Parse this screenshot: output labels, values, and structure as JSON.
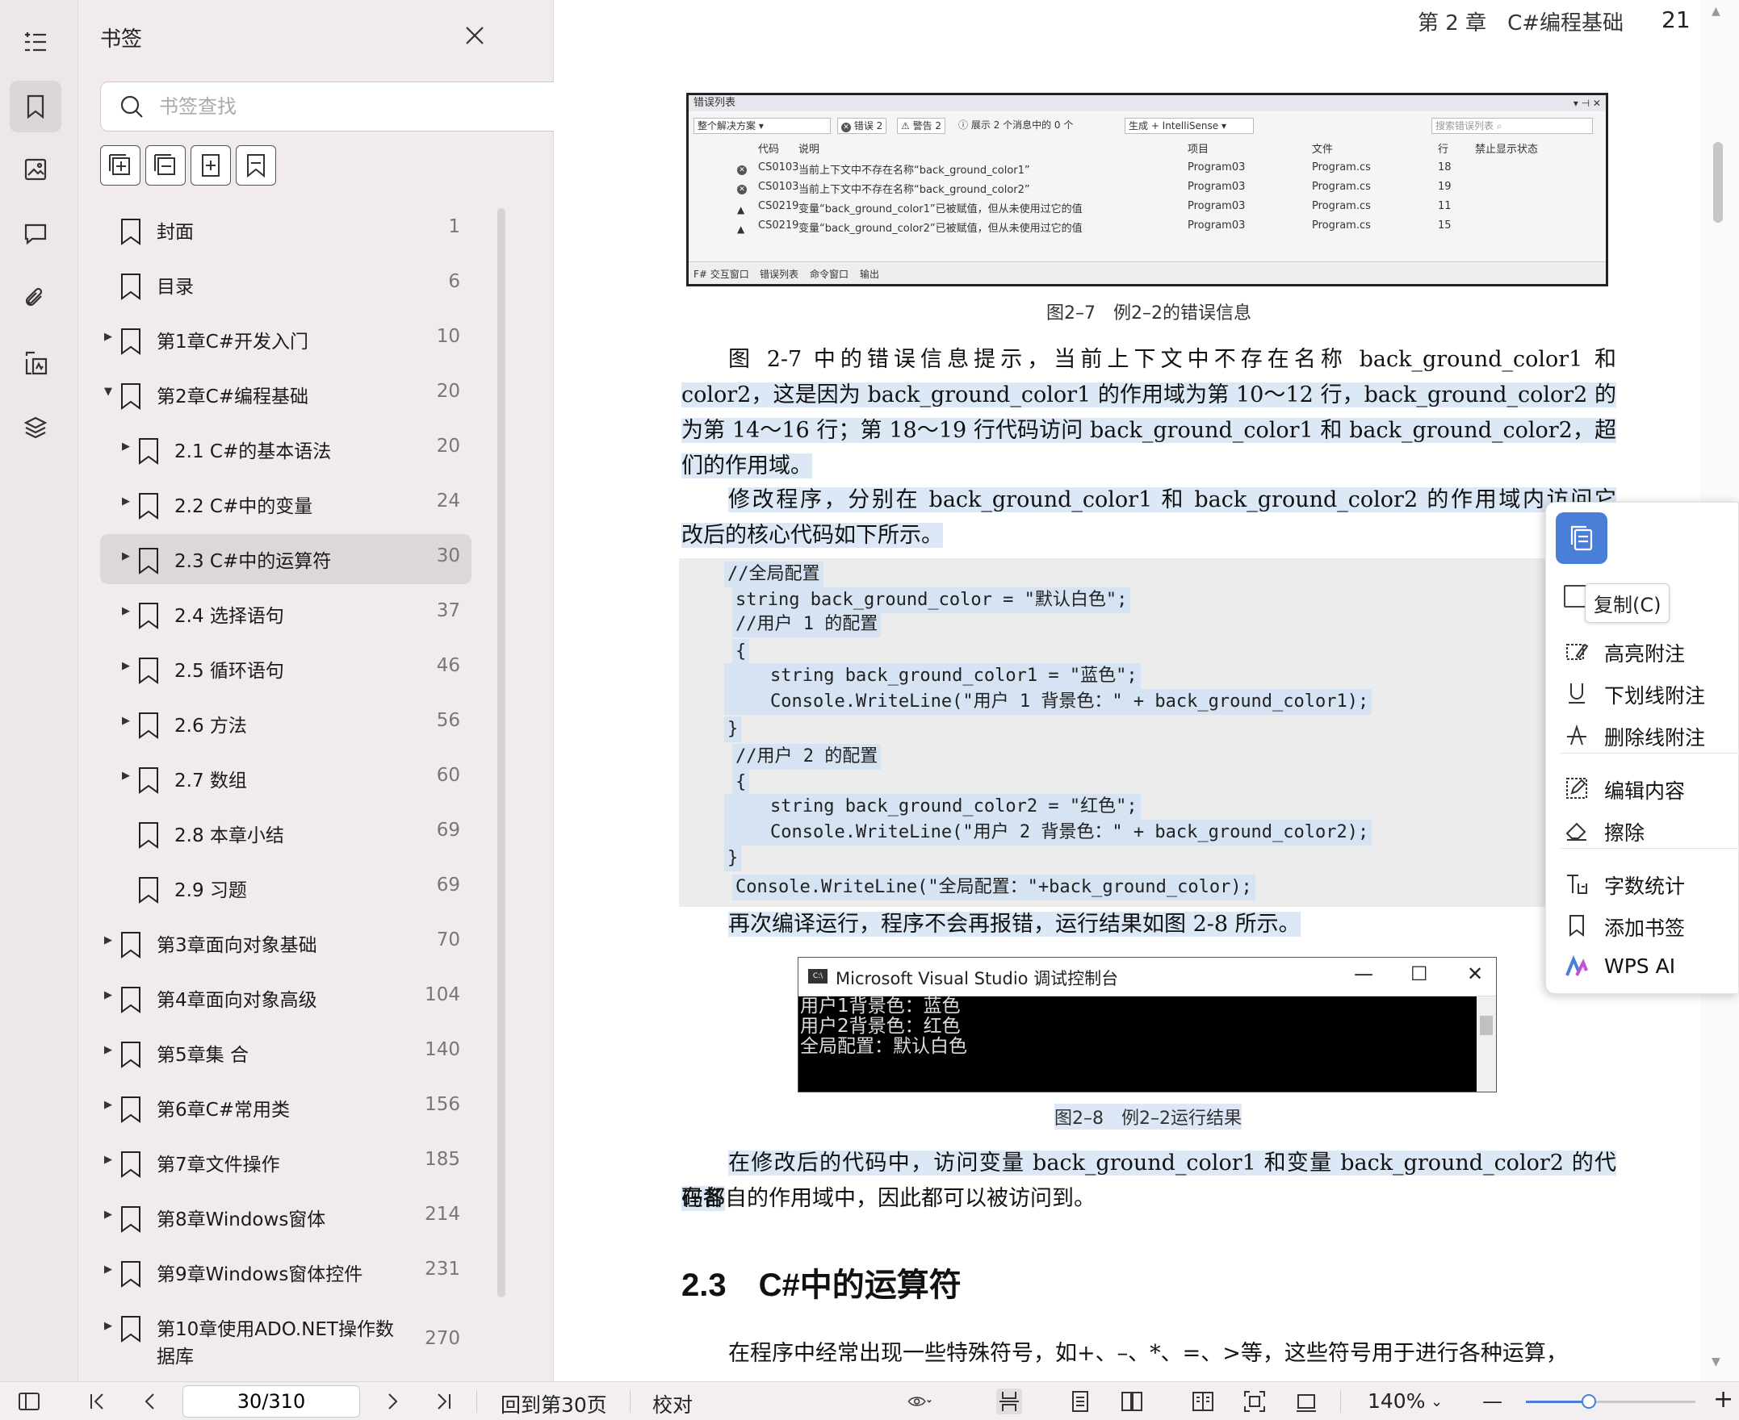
{
  "rail": {
    "items": [
      "toc-icon",
      "bookmark-icon",
      "image-icon",
      "comment-icon",
      "attachment-icon",
      "signature-icon",
      "layers-icon"
    ]
  },
  "panel": {
    "title": "书签",
    "search_placeholder": "书签查找",
    "bookmarks": [
      {
        "label": "封面",
        "page": "1",
        "level": 0,
        "expander": ""
      },
      {
        "label": "目录",
        "page": "6",
        "level": 0,
        "expander": ""
      },
      {
        "label": "第1章C#开发入门",
        "page": "10",
        "level": 0,
        "expander": "▶"
      },
      {
        "label": "第2章C#编程基础",
        "page": "20",
        "level": 0,
        "expander": "▼"
      },
      {
        "label": "2.1 C#的基本语法",
        "page": "20",
        "level": 1,
        "expander": "▶"
      },
      {
        "label": "2.2 C#中的变量",
        "page": "24",
        "level": 1,
        "expander": "▶"
      },
      {
        "label": "2.3 C#中的运算符",
        "page": "30",
        "level": 1,
        "expander": "▶",
        "active": true
      },
      {
        "label": "2.4 选择语句",
        "page": "37",
        "level": 1,
        "expander": "▶"
      },
      {
        "label": "2.5 循环语句",
        "page": "46",
        "level": 1,
        "expander": "▶"
      },
      {
        "label": "2.6 方法",
        "page": "56",
        "level": 1,
        "expander": "▶"
      },
      {
        "label": "2.7 数组",
        "page": "60",
        "level": 1,
        "expander": "▶"
      },
      {
        "label": "2.8 本章小结",
        "page": "69",
        "level": 1,
        "expander": ""
      },
      {
        "label": "2.9 习题",
        "page": "69",
        "level": 1,
        "expander": ""
      },
      {
        "label": "第3章面向对象基础",
        "page": "70",
        "level": 0,
        "expander": "▶"
      },
      {
        "label": "第4章面向对象高级",
        "page": "104",
        "level": 0,
        "expander": "▶"
      },
      {
        "label": "第5章集 合",
        "page": "140",
        "level": 0,
        "expander": "▶"
      },
      {
        "label": "第6章C#常用类",
        "page": "156",
        "level": 0,
        "expander": "▶"
      },
      {
        "label": "第7章文件操作",
        "page": "185",
        "level": 0,
        "expander": "▶"
      },
      {
        "label": "第8章Windows窗体",
        "page": "214",
        "level": 0,
        "expander": "▶"
      },
      {
        "label": "第9章Windows窗体控件",
        "page": "231",
        "level": 0,
        "expander": "▶"
      },
      {
        "label": "第10章使用ADO.NET操作数",
        "label2": "据库",
        "page": "270",
        "level": 0,
        "expander": "▶"
      }
    ]
  },
  "doc": {
    "running_head": "第 2 章　C#编程基础",
    "page_number": "21",
    "fig1": {
      "title": "错误列表",
      "scope": "整个解决方案",
      "errors_btn": "错误 2",
      "warnings_btn": "警告 2",
      "messages_btn": "展示 2 个消息中的 0 个",
      "build_filter": "生成 + IntelliSense",
      "search_placeholder": "搜索错误列表",
      "headers": [
        "代码",
        "说明",
        "项目",
        "文件",
        "行",
        "禁止显示状态"
      ],
      "rows": [
        {
          "kind": "error",
          "code": "CS0103",
          "desc": "当前上下文中不存在名称“back_ground_color1”",
          "project": "Program03",
          "file": "Program.cs",
          "line": "18"
        },
        {
          "kind": "error",
          "code": "CS0103",
          "desc": "当前上下文中不存在名称“back_ground_color2”",
          "project": "Program03",
          "file": "Program.cs",
          "line": "19"
        },
        {
          "kind": "warning",
          "code": "CS0219",
          "desc": "变量“back_ground_color1”已被赋值，但从未使用过它的值",
          "project": "Program03",
          "file": "Program.cs",
          "line": "11"
        },
        {
          "kind": "warning",
          "code": "CS0219",
          "desc": "变量“back_ground_color2”已被赋值，但从未使用过它的值",
          "project": "Program03",
          "file": "Program.cs",
          "line": "15"
        }
      ],
      "bottom_tabs": [
        "F# 交互窗口",
        "错误列表",
        "命令窗口",
        "输出"
      ]
    },
    "fig1_caption": "图2–7　例2–2的错误信息",
    "para1_a": "图 2-7 中的错误信息提示，当前上下文中不存在名称 back_ground_color1 和 back_ground_",
    "para1_b": "color2，这是因为 back_ground_color1 的作用域为第 10～12 行，back_ground_color2 的作用域",
    "para1_c": "为第 14～16 行；第 18～19 行代码访问 back_ground_color1 和 back_ground_color2，超出了它",
    "para1_d": "们的作用域。",
    "para2_a": "修改程序，分别在 back_ground_color1 和 back_ground_color2 的作用域内访问它们。修",
    "para2_b": "改后的核心代码如下所示。",
    "code": [
      "//全局配置",
      "string back_ground_color = \"默认白色\";",
      "//用户 1 的配置",
      "{",
      "    string back_ground_color1 = \"蓝色\";",
      "    Console.WriteLine(\"用户 1 背景色：\" + back_ground_color1);",
      "}",
      "//用户 2 的配置",
      "{",
      "    string back_ground_color2 = \"红色\";",
      "    Console.WriteLine(\"用户 2 背景色：\" + back_ground_color2);",
      "}",
      "Console.WriteLine(\"全局配置：\"+back_ground_color);"
    ],
    "para3": "再次编译运行，程序不会再报错，运行结果如图 2-8 所示。",
    "console_title": "Microsoft Visual Studio 调试控制台",
    "console_output": "用户1背景色：蓝色\n用户2背景色：红色\n全局配置：默认白色",
    "fig2_caption": "图2–8　例2–2运行结果",
    "para4_a": "在修改后的代码中，访问变量 back_ground_color1 和变量 back_ground_color2 的代码都",
    "para4_b": "在各自的作用域中，因此都可以被访问到。",
    "section_heading": "2.3　C#中的运算符",
    "para5": "在程序中经常出现一些特殊符号，如+、–、*、=、>等，这些符号用于进行各种运算，"
  },
  "context_menu": {
    "tooltip": "复制(C)",
    "items": [
      {
        "icon": "highlight-note-icon",
        "label": "高亮附注"
      },
      {
        "icon": "underline-note-icon",
        "label": "下划线附注"
      },
      {
        "icon": "strikethrough-note-icon",
        "label": "删除线附注"
      },
      {
        "icon": "edit-content-icon",
        "label": "编辑内容"
      },
      {
        "icon": "eraser-icon",
        "label": "擦除"
      },
      {
        "icon": "word-count-icon",
        "label": "字数统计"
      },
      {
        "icon": "add-bookmark-icon",
        "label": "添加书签"
      },
      {
        "icon": "wps-ai-icon",
        "label": "WPS AI"
      }
    ]
  },
  "statusbar": {
    "page_value": "30/310",
    "back_to_page": "回到第30页",
    "proofread": "校对",
    "zoom": "140%",
    "zoom_fraction": 0.37
  },
  "colors": {
    "accent": "#4a7fd8",
    "selection": "#dce8f6"
  }
}
